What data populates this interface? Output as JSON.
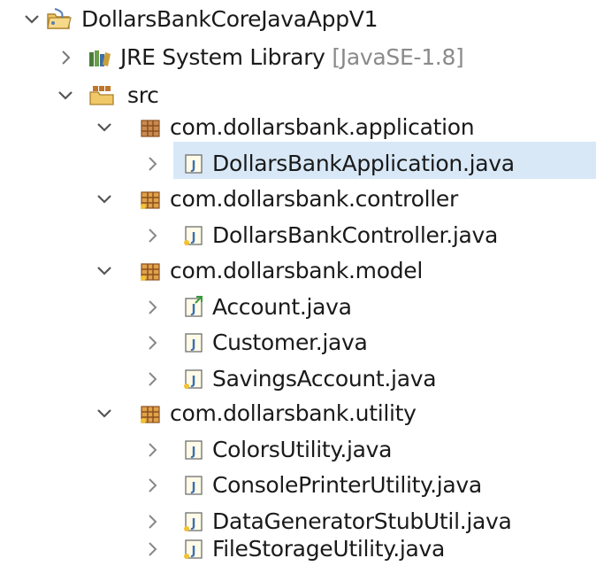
{
  "project_explorer": {
    "project": {
      "name": "DollarsBankCoreJavaAppV1",
      "expanded": true
    },
    "library": {
      "name": "JRE System Library",
      "decoration": "[JavaSE-1.8]",
      "expanded": false
    },
    "source_folder": {
      "name": "src",
      "expanded": true
    },
    "packages": [
      {
        "name": "com.dollarsbank.application",
        "expanded": true,
        "files": [
          {
            "name": "DollarsBankApplication.java",
            "selected": true
          }
        ]
      },
      {
        "name": "com.dollarsbank.controller",
        "expanded": true,
        "files": [
          {
            "name": "DollarsBankController.java",
            "selected": false
          }
        ]
      },
      {
        "name": "com.dollarsbank.model",
        "expanded": true,
        "files": [
          {
            "name": "Account.java",
            "selected": false
          },
          {
            "name": "Customer.java",
            "selected": false
          },
          {
            "name": "SavingsAccount.java",
            "selected": false
          }
        ]
      },
      {
        "name": "com.dollarsbank.utility",
        "expanded": true,
        "files": [
          {
            "name": "ColorsUtility.java",
            "selected": false
          },
          {
            "name": "ConsolePrinterUtility.java",
            "selected": false
          },
          {
            "name": "DataGeneratorStubUtil.java",
            "selected": false
          },
          {
            "name": "FileStorageUtility.java",
            "selected": false
          }
        ]
      }
    ],
    "colors": {
      "selection": "#d8e8f7",
      "package_brown": "#a0602a",
      "file_blue": "#3b6fb6",
      "chevron": "#555555",
      "decoration_gray": "#8a8a8a"
    }
  }
}
